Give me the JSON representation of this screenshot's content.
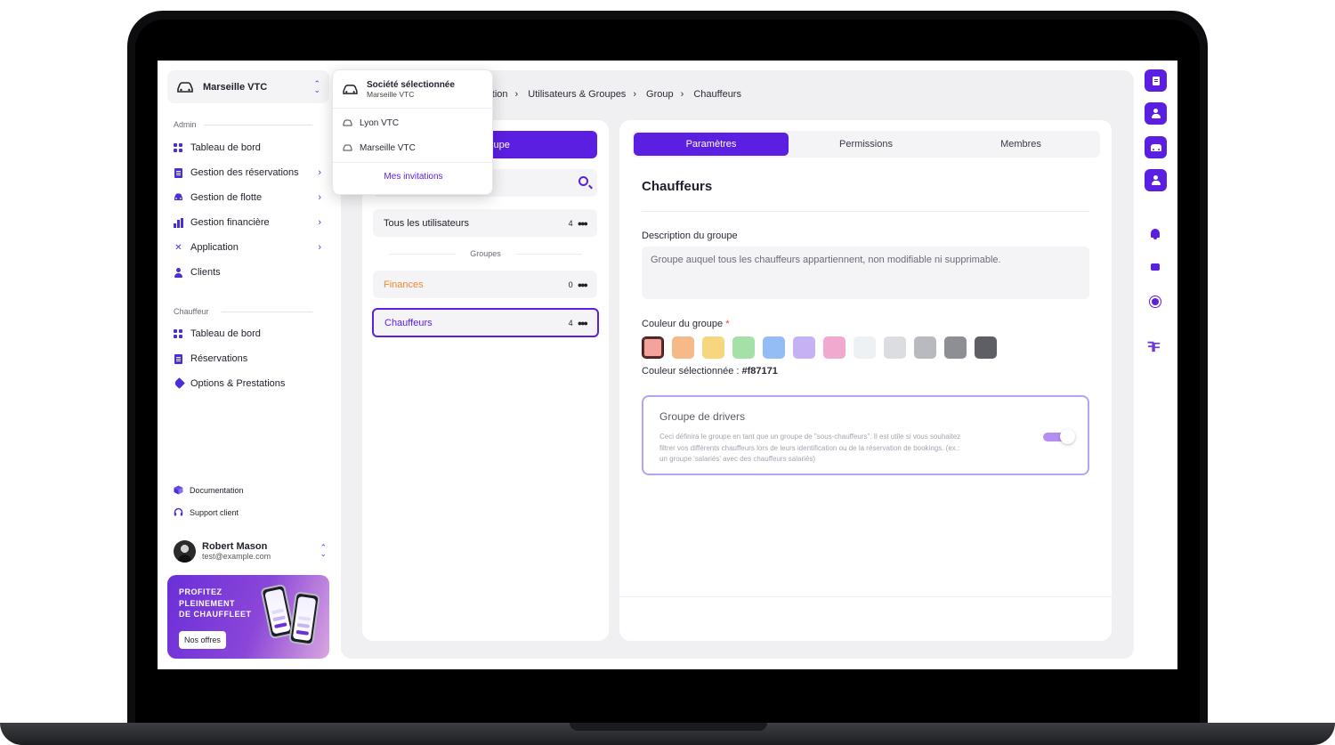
{
  "app": {
    "company": "Marseille VTC"
  },
  "sidebar": {
    "admin_label": "Admin",
    "admin_items": [
      {
        "label": "Tableau de bord",
        "icon": "grid-icon",
        "has_arrow": false
      },
      {
        "label": "Gestion des réservations",
        "icon": "document-icon",
        "has_arrow": true
      },
      {
        "label": "Gestion de flotte",
        "icon": "car-icon",
        "has_arrow": true
      },
      {
        "label": "Gestion financière",
        "icon": "bar-chart-icon",
        "has_arrow": true
      },
      {
        "label": "Application",
        "icon": "tools-icon",
        "has_arrow": true
      },
      {
        "label": "Clients",
        "icon": "user-icon",
        "has_arrow": false
      }
    ],
    "chauffeur_label": "Chauffeur",
    "chauffeur_items": [
      {
        "label": "Tableau de bord",
        "icon": "grid-icon"
      },
      {
        "label": "Réservations",
        "icon": "document-icon"
      },
      {
        "label": "Options & Prestations",
        "icon": "tag-icon"
      }
    ],
    "documentation": "Documentation",
    "support": "Support client",
    "user": {
      "name": "Robert Mason",
      "email": "test@example.com"
    },
    "promo": {
      "line1": "PROFITEZ",
      "line2": "PLEINEMENT",
      "line3": "DE CHAUFFLEET",
      "button": "Nos offres"
    }
  },
  "dropdown": {
    "title": "Société sélectionnée",
    "subtitle": "Marseille VTC",
    "items": [
      "Lyon VTC",
      "Marseille VTC"
    ],
    "invitations": "Mes invitations"
  },
  "breadcrumb": [
    "ration",
    "Utilisateurs & Groupes",
    "Group",
    "Chauffeurs"
  ],
  "groups_panel": {
    "new_group_button": "eau groupe",
    "all_users": {
      "label": "Tous les utilisateurs",
      "count": "4"
    },
    "groups_label": "Groupes",
    "groups": [
      {
        "label": "Finances",
        "count": "0",
        "color": "#f08a2c"
      },
      {
        "label": "Chauffeurs",
        "count": "4",
        "color": "#5a1fe0"
      }
    ]
  },
  "details": {
    "tabs": [
      "Paramètres",
      "Permissions",
      "Membres"
    ],
    "active_tab": "Paramètres",
    "title": "Chauffeurs",
    "description_label": "Description du groupe",
    "description_value": "Groupe auquel tous les chauffeurs appartiennent, non modifiable ni supprimable.",
    "color_label": "Couleur du groupe",
    "required_mark": "*",
    "colors": [
      "#f4a29c",
      "#f6b98a",
      "#f6d77d",
      "#a4e0a7",
      "#94bdf6",
      "#c5b2f4",
      "#f2a9cf",
      "#eef1f4",
      "#dcdde1",
      "#b8babf",
      "#8d8f94",
      "#5d5f64"
    ],
    "selected_color_label": "Couleur sélectionnée :",
    "selected_color_value": "#f87171",
    "drivers_group": {
      "title": "Groupe de drivers",
      "description": "Ceci définira le groupe en tant que un groupe de \"sous-chauffeurs\". Il est utile si vous souhaitez filtrer vos différents chauffeurs lors de leurs identification ou de la réservation de bookings. (ex.: un groupe 'salariés' avec des chauffeurs salariés)",
      "enabled": true
    }
  },
  "theme": {
    "accent": "#5a1fe0"
  }
}
